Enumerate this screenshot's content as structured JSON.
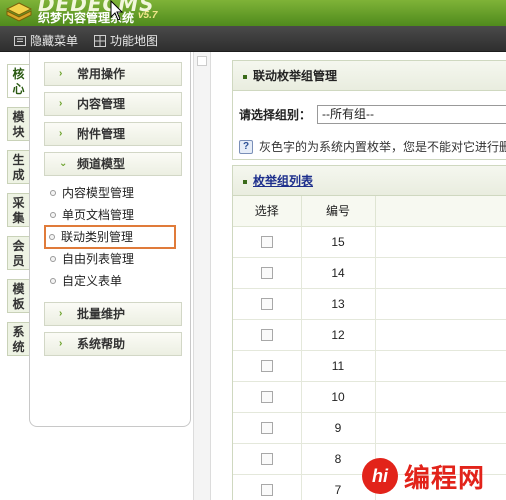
{
  "header": {
    "logo_en": "DEDECMS",
    "logo_cn": "织梦内容管理系统",
    "version": "v5.7"
  },
  "toolbar": {
    "hide_menu": "隐藏菜单",
    "site_map": "功能地图"
  },
  "vtabs": [
    "核心",
    "模块",
    "生成",
    "采集",
    "会员",
    "模板",
    "系统"
  ],
  "menu": {
    "groups": [
      "常用操作",
      "内容管理",
      "附件管理",
      "频道模型",
      "批量维护",
      "系统帮助"
    ],
    "submenu": [
      "内容模型管理",
      "单页文档管理",
      "联动类别管理",
      "自由列表管理",
      "自定义表单"
    ]
  },
  "box1": {
    "title": "联动枚举组管理",
    "select_label": "请选择组别：",
    "select_value": "--所有组--",
    "hint": "灰色字的为系统内置枚举，您是不能对它进行删"
  },
  "box2": {
    "title": "枚举组列表",
    "headers": [
      "选择",
      "编号"
    ],
    "ids": [
      "15",
      "14",
      "13",
      "12",
      "11",
      "10",
      "9",
      "8",
      "7"
    ],
    "row12_extra": "系"
  },
  "watermark": {
    "badge": "hi",
    "text": "编程网"
  }
}
